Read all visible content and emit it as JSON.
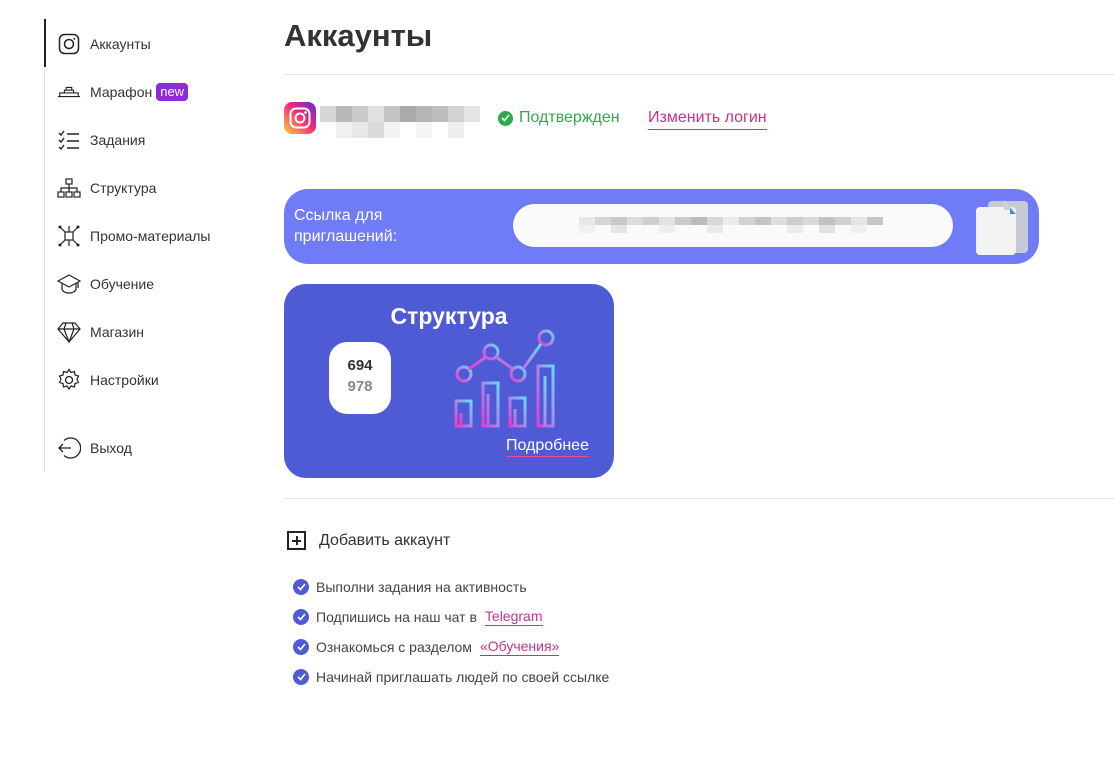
{
  "sidebar": {
    "items": [
      {
        "label": "Аккаунты",
        "icon": "instagram-icon",
        "active": true
      },
      {
        "label": "Марафон",
        "icon": "marathon-icon",
        "badge": "new"
      },
      {
        "label": "Задания",
        "icon": "task-list-icon"
      },
      {
        "label": "Структура",
        "icon": "hierarchy-icon"
      },
      {
        "label": "Промо-материалы",
        "icon": "network-icon"
      },
      {
        "label": "Обучение",
        "icon": "graduation-cap-icon"
      },
      {
        "label": "Магазин",
        "icon": "diamond-icon"
      },
      {
        "label": "Настройки",
        "icon": "gear-icon"
      },
      {
        "label": "Выход",
        "icon": "logout-icon"
      }
    ]
  },
  "header": {
    "title": "Аккаунты"
  },
  "account": {
    "status": "Подтвержден",
    "change_login": "Изменить логин",
    "status_color": "#2fa84f"
  },
  "invite": {
    "label": "Ссылка для приглашений:"
  },
  "structure_card": {
    "title": "Структура",
    "count_primary": "694",
    "count_secondary": "978",
    "more_link": "Подробнее",
    "bg_color": "#4f5bd5"
  },
  "add_account": {
    "label": "Добавить аккаунт"
  },
  "tips": [
    {
      "text": "Выполни задания на активность"
    },
    {
      "text": "Подпишись на наш чат в",
      "link": "Telegram"
    },
    {
      "text": "Ознакомься с разделом",
      "link": "«Обучения»"
    },
    {
      "text": "Начинай приглашать людей по своей ссылке"
    }
  ],
  "colors": {
    "accent": "#4f5bd5",
    "invite_bg": "#6f7bf7",
    "link": "#c2348a"
  }
}
